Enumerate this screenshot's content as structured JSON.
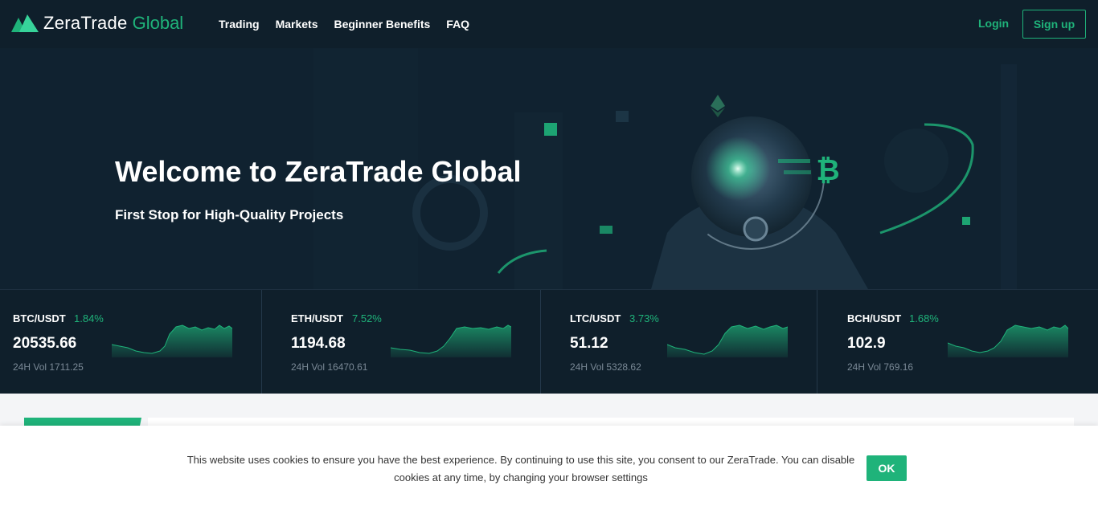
{
  "brand": {
    "name": "ZeraTrade",
    "accent": "Global",
    "accent_color": "#1fb37a"
  },
  "nav": [
    {
      "label": "Trading"
    },
    {
      "label": "Markets"
    },
    {
      "label": "Beginner Benefits"
    },
    {
      "label": "FAQ"
    }
  ],
  "auth": {
    "login": "Login",
    "signup": "Sign up"
  },
  "hero": {
    "title": "Welcome to ZeraTrade Global",
    "subtitle": "First Stop for High-Quality Projects"
  },
  "tickers": [
    {
      "pair": "BTC/USDT",
      "change": "1.84%",
      "price": "20535.66",
      "volume": "24H Vol 1711.25"
    },
    {
      "pair": "ETH/USDT",
      "change": "7.52%",
      "price": "1194.68",
      "volume": "24H Vol 16470.61"
    },
    {
      "pair": "LTC/USDT",
      "change": "3.73%",
      "price": "51.12",
      "volume": "24H Vol 5328.62"
    },
    {
      "pair": "BCH/USDT",
      "change": "1.68%",
      "price": "102.9",
      "volume": "24H Vol 769.16"
    }
  ],
  "cookie": {
    "text": "This website uses cookies to ensure you have the best experience. By continuing to use this site, you consent to our ZeraTrade. You can disable cookies at any time, by changing your browser settings",
    "ok": "OK"
  },
  "icons": {
    "logo": "zeratrade-logo-icon",
    "eth": "ethereum-icon",
    "btc": "bitcoin-icon"
  }
}
